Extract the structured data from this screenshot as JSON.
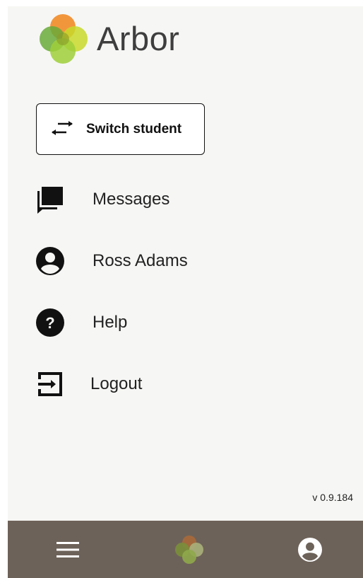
{
  "app": {
    "logo_text": "Arbor",
    "version": "v 0.9.184"
  },
  "switch_student": {
    "label": "Switch student",
    "icon": "swap-arrows-icon"
  },
  "menu": {
    "items": [
      {
        "label": "Messages",
        "icon": "messages-icon"
      },
      {
        "label": "Ross Adams",
        "icon": "account-circle-icon"
      },
      {
        "label": "Help",
        "icon": "help-circle-icon"
      },
      {
        "label": "Logout",
        "icon": "logout-icon"
      }
    ]
  },
  "bottom_nav": {
    "items": [
      {
        "icon": "hamburger-menu-icon"
      },
      {
        "icon": "arbor-logo-icon"
      },
      {
        "icon": "account-circle-icon"
      }
    ]
  },
  "colors": {
    "panel_background": "#f6f6f4",
    "bottom_bar": "#6d6259",
    "logo_orange": "#f28c28",
    "logo_green": "#6aaa3a",
    "logo_lime": "#c8d92a",
    "logo_text": "#3e3e3e"
  }
}
